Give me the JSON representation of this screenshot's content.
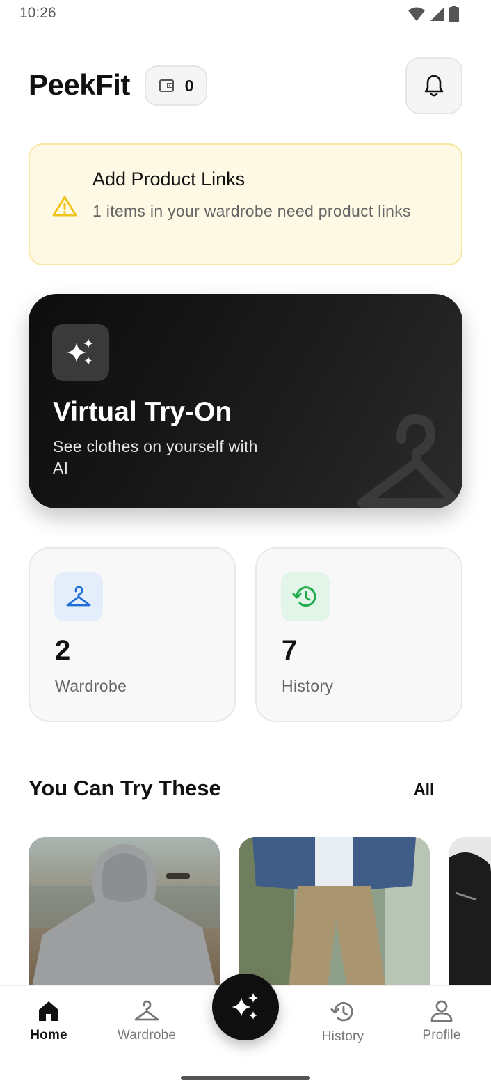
{
  "status_bar": {
    "time": "10:26"
  },
  "header": {
    "app_title": "PeekFit",
    "credits_value": "0"
  },
  "alert": {
    "title": "Add Product Links",
    "text": "1 items in your wardrobe need product links",
    "accent_color": "#f0c419"
  },
  "hero": {
    "title": "Virtual Try-On",
    "subtitle": "See clothes on yourself with AI"
  },
  "stats": [
    {
      "value": "2",
      "label": "Wardrobe",
      "icon": "hanger-icon",
      "icon_color": "#1f6fd6",
      "icon_bg": "#e4eefb"
    },
    {
      "value": "7",
      "label": "History",
      "icon": "history-icon",
      "icon_color": "#1faa4e",
      "icon_bg": "#e2f5e8"
    }
  ],
  "section": {
    "title": "You Can Try These",
    "link_label": "All"
  },
  "products": [
    {
      "name": "grey hoodie photo"
    },
    {
      "name": "denim jacket and khaki pants photo"
    },
    {
      "name": "black leather jacket photo"
    }
  ],
  "bottom_nav": {
    "items": [
      {
        "label": "Home",
        "icon": "home-icon",
        "active": true
      },
      {
        "label": "Wardrobe",
        "icon": "hanger-icon",
        "active": false
      },
      {
        "label": "History",
        "icon": "history-icon",
        "active": false
      },
      {
        "label": "Profile",
        "icon": "user-icon",
        "active": false
      }
    ],
    "fab_icon": "sparkles-icon"
  }
}
